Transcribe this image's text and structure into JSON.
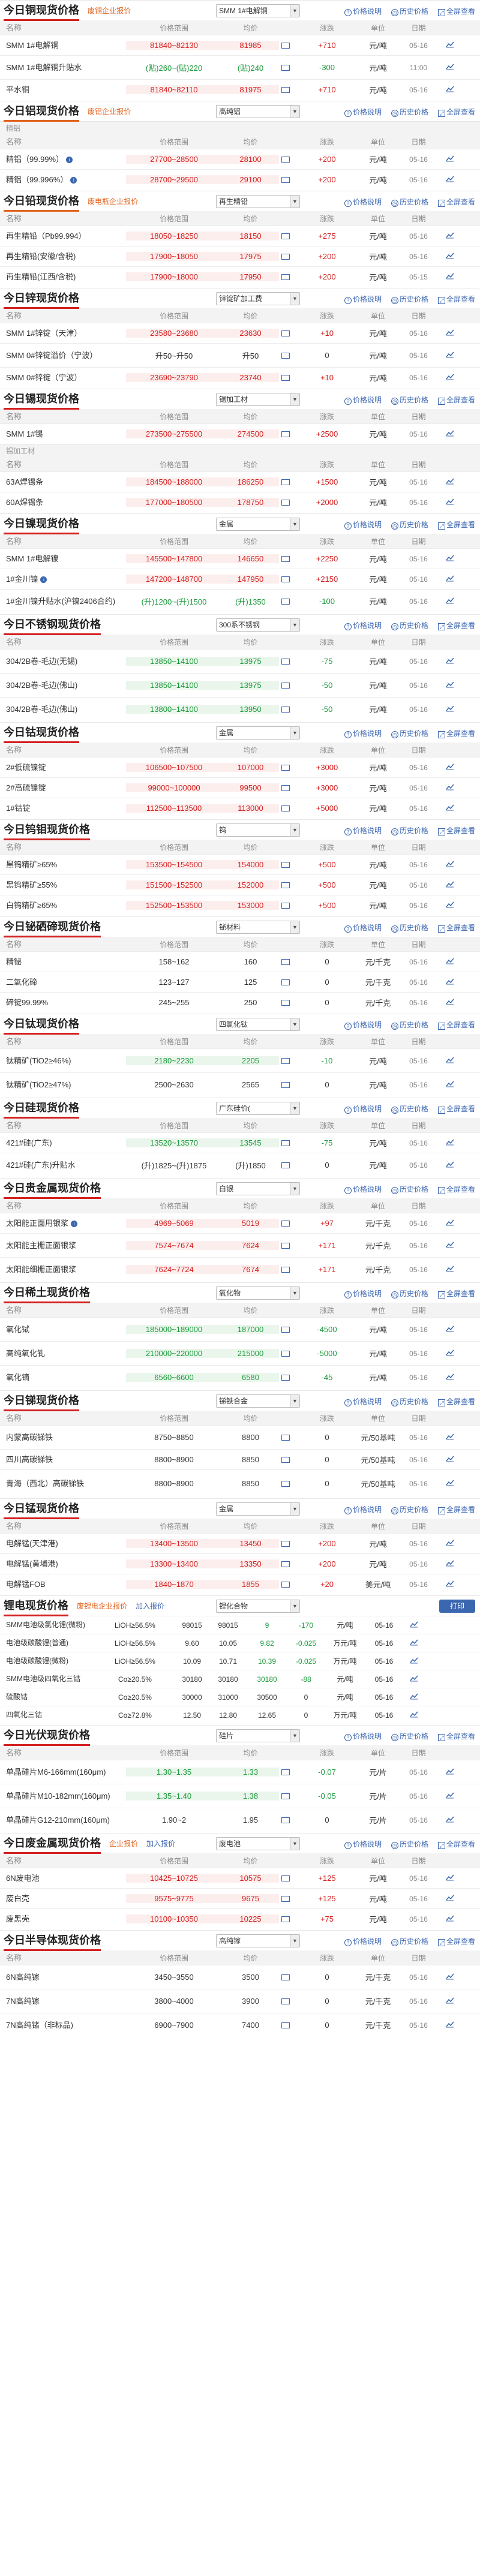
{
  "columns": {
    "name": "名称",
    "range": "价格范围",
    "avg": "均价",
    "chg": "涨跌",
    "unit": "单位",
    "date": "日期"
  },
  "group_labels": {
    "spot": "现货",
    "mid": "中间品",
    "lead_spot": "精铝",
    "zinc_spot": "锌现货",
    "tin": "锡加工材",
    "nickel": "镍"
  },
  "sections": [
    {
      "id": "copper",
      "title": "今日铜现货价格",
      "tag": "废铜企业报价",
      "select": "SMM 1#电解铜",
      "links": [
        "价格说明",
        "历史价格",
        "全屏查看"
      ],
      "rows": [
        {
          "name": "SMM 1#电解铜",
          "range": "81840~82130",
          "avg": "81985",
          "chg": "+710",
          "unit": "元/吨",
          "date": "05-16",
          "dir": "up",
          "hl": true
        },
        {
          "name": "SMM 1#电解铜升贴水",
          "range": "(贴)260~(贴)220",
          "avg": "(贴)240",
          "chg": "-300",
          "unit": "元/吨",
          "date": "11:00",
          "dir": "dn",
          "hl": false,
          "tall": true
        },
        {
          "name": "平水铜",
          "range": "81840~82110",
          "avg": "81975",
          "chg": "+710",
          "unit": "元/吨",
          "date": "05-16",
          "dir": "up",
          "hl": true
        }
      ]
    },
    {
      "id": "aluminum",
      "title": "今日铝现货价格",
      "tag": "废铝企业报价",
      "select": "高纯铝",
      "links": [
        "价格说明",
        "历史价格",
        "全屏查看"
      ],
      "group": "精铝",
      "rows": [
        {
          "name": "精铝（99.99%）",
          "range": "27700~28500",
          "avg": "28100",
          "chg": "+200",
          "unit": "元/吨",
          "date": "05-16",
          "dir": "up",
          "hl": true,
          "info": true
        },
        {
          "name": "精铝（99.996%）",
          "range": "28700~29500",
          "avg": "29100",
          "chg": "+200",
          "unit": "元/吨",
          "date": "05-16",
          "dir": "up",
          "hl": true,
          "info": true
        }
      ]
    },
    {
      "id": "lead",
      "title": "今日铅现货价格",
      "tag": "废电瓶企业报价",
      "select": "再生精铅",
      "links": [
        "价格说明",
        "历史价格",
        "全屏查看"
      ],
      "rows": [
        {
          "name": "再生精铅（Pb99.994）",
          "range": "18050~18250",
          "avg": "18150",
          "chg": "+275",
          "unit": "元/吨",
          "date": "05-16",
          "dir": "up",
          "hl": true
        },
        {
          "name": "再生精铅(安徽/含税)",
          "range": "17900~18050",
          "avg": "17975",
          "chg": "+200",
          "unit": "元/吨",
          "date": "05-16",
          "dir": "up",
          "hl": true
        },
        {
          "name": "再生精铅(江西/含税)",
          "range": "17900~18000",
          "avg": "17950",
          "chg": "+200",
          "unit": "元/吨",
          "date": "05-15",
          "dir": "up",
          "hl": true
        }
      ]
    },
    {
      "id": "zinc",
      "title": "今日锌现货价格",
      "tag": "",
      "select": "锌锭矿加工费",
      "links": [
        "价格说明",
        "历史价格",
        "全屏查看"
      ],
      "rows": [
        {
          "name": "SMM 1#锌锭（天津）",
          "range": "23580~23680",
          "avg": "23630",
          "chg": "+10",
          "unit": "元/吨",
          "date": "05-16",
          "dir": "up",
          "hl": true
        },
        {
          "name": "SMM 0#锌锭溢价（宁波）",
          "range": "升50~升50",
          "avg": "升50",
          "chg": "0",
          "unit": "元/吨",
          "date": "05-16",
          "dir": "flat",
          "hl": false,
          "tall": true
        },
        {
          "name": "SMM 0#锌锭（宁波）",
          "range": "23690~23790",
          "avg": "23740",
          "chg": "+10",
          "unit": "元/吨",
          "date": "05-16",
          "dir": "up",
          "hl": true
        }
      ]
    },
    {
      "id": "tin",
      "title": "今日锡现货价格",
      "tag": "",
      "select": "锡加工材",
      "links": [
        "价格说明",
        "历史价格",
        "全屏查看"
      ],
      "rows": [
        {
          "name": "SMM 1#锡",
          "range": "273500~275500",
          "avg": "274500",
          "chg": "+2500",
          "unit": "元/吨",
          "date": "05-16",
          "dir": "up",
          "hl": true
        }
      ],
      "group": "锡加工材",
      "hdr_after_group": true,
      "rows2": [
        {
          "name": "63A焊锡条",
          "range": "184500~188000",
          "avg": "186250",
          "chg": "+1500",
          "unit": "元/吨",
          "date": "05-16",
          "dir": "up",
          "hl": true
        },
        {
          "name": "60A焊锡条",
          "range": "177000~180500",
          "avg": "178750",
          "chg": "+2000",
          "unit": "元/吨",
          "date": "05-16",
          "dir": "up",
          "hl": true
        }
      ]
    },
    {
      "id": "nickel",
      "title": "今日镍现货价格",
      "tag": "",
      "select": "金属",
      "links": [
        "价格说明",
        "历史价格",
        "全屏查看"
      ],
      "rows": [
        {
          "name": "SMM 1#电解镍",
          "range": "145500~147800",
          "avg": "146650",
          "chg": "+2250",
          "unit": "元/吨",
          "date": "05-16",
          "dir": "up",
          "hl": true
        },
        {
          "name": "1#金川镍",
          "range": "147200~148700",
          "avg": "147950",
          "chg": "+2150",
          "unit": "元/吨",
          "date": "05-16",
          "dir": "up",
          "hl": true,
          "info": true
        },
        {
          "name": "1#金川镍升贴水(沪镍2406合约)",
          "range": "(升)1200~(升)1500",
          "avg": "(升)1350",
          "chg": "-100",
          "unit": "元/吨",
          "date": "05-16",
          "dir": "dn",
          "hl": false,
          "tall": true
        }
      ]
    },
    {
      "id": "stainless",
      "title": "今日不锈钢现货价格",
      "tag": "",
      "select": "300系不锈钢",
      "links": [
        "价格说明",
        "历史价格",
        "全屏查看"
      ],
      "rows": [
        {
          "name": "304/2B卷-毛边(无锡)",
          "range": "13850~14100",
          "avg": "13975",
          "chg": "-75",
          "unit": "元/吨",
          "date": "05-16",
          "dir": "dn",
          "hl": "g",
          "tall": true
        },
        {
          "name": "304/2B卷-毛边(佛山)",
          "range": "13850~14100",
          "avg": "13975",
          "chg": "-50",
          "unit": "元/吨",
          "date": "05-16",
          "dir": "dn",
          "hl": "g",
          "tall": true
        },
        {
          "name": "304/2B卷-毛边(佛山)",
          "range": "13800~14100",
          "avg": "13950",
          "chg": "-50",
          "unit": "元/吨",
          "date": "05-16",
          "dir": "dn",
          "hl": "g",
          "tall": true
        }
      ]
    },
    {
      "id": "cobalt",
      "title": "今日钴现货价格",
      "tag": "",
      "select": "金属",
      "links": [
        "价格说明",
        "历史价格",
        "全屏查看"
      ],
      "rows": [
        {
          "name": "2#低硫镍锭",
          "range": "106500~107500",
          "avg": "107000",
          "chg": "+3000",
          "unit": "元/吨",
          "date": "05-16",
          "dir": "up",
          "hl": true
        },
        {
          "name": "2#高硫镍锭",
          "range": "99000~100000",
          "avg": "99500",
          "chg": "+3000",
          "unit": "元/吨",
          "date": "05-16",
          "dir": "up",
          "hl": true
        },
        {
          "name": "1#钴锭",
          "range": "112500~113500",
          "avg": "113000",
          "chg": "+5000",
          "unit": "元/吨",
          "date": "05-16",
          "dir": "up",
          "hl": true
        }
      ]
    },
    {
      "id": "tungsten",
      "title": "今日钨钼现货价格",
      "tag": "",
      "select": "钨",
      "links": [
        "价格说明",
        "历史价格",
        "全屏查看"
      ],
      "rows": [
        {
          "name": "黑钨精矿≥65%",
          "range": "153500~154500",
          "avg": "154000",
          "chg": "+500",
          "unit": "元/吨",
          "date": "05-16",
          "dir": "up",
          "hl": true
        },
        {
          "name": "黑钨精矿≥55%",
          "range": "151500~152500",
          "avg": "152000",
          "chg": "+500",
          "unit": "元/吨",
          "date": "05-16",
          "dir": "up",
          "hl": true
        },
        {
          "name": "白钨精矿≥65%",
          "range": "152500~153500",
          "avg": "153000",
          "chg": "+500",
          "unit": "元/吨",
          "date": "05-16",
          "dir": "up",
          "hl": true
        }
      ]
    },
    {
      "id": "bismuth",
      "title": "今日铋硒碲现货价格",
      "tag": "",
      "select": "铋材料",
      "links": [
        "价格说明",
        "历史价格",
        "全屏查看"
      ],
      "rows": [
        {
          "name": "精铋",
          "range": "158~162",
          "avg": "160",
          "chg": "0",
          "unit": "元/千克",
          "date": "05-16",
          "dir": "flat",
          "hl": false
        },
        {
          "name": "二氧化碲",
          "range": "123~127",
          "avg": "125",
          "chg": "0",
          "unit": "元/千克",
          "date": "05-16",
          "dir": "flat",
          "hl": false
        },
        {
          "name": "碲锭99.99%",
          "range": "245~255",
          "avg": "250",
          "chg": "0",
          "unit": "元/千克",
          "date": "05-16",
          "dir": "flat",
          "hl": false
        }
      ]
    },
    {
      "id": "titanium",
      "title": "今日钛现货价格",
      "tag": "",
      "select": "四氯化钛",
      "links": [
        "价格说明",
        "历史价格",
        "全屏查看"
      ],
      "rows": [
        {
          "name": "钛精矿(TiO2≥46%)",
          "range": "2180~2230",
          "avg": "2205",
          "chg": "-10",
          "unit": "元/吨",
          "date": "05-16",
          "dir": "dn",
          "hl": "g",
          "tall": true
        },
        {
          "name": "钛精矿(TiO2≥47%)",
          "range": "2500~2630",
          "avg": "2565",
          "chg": "0",
          "unit": "元/吨",
          "date": "05-16",
          "dir": "flat",
          "hl": false,
          "tall": true
        }
      ]
    },
    {
      "id": "silicon",
      "title": "今日硅现货价格",
      "tag": "",
      "select": "广东硅价(",
      "links": [
        "价格说明",
        "历史价格",
        "全屏查看"
      ],
      "colhdr": true,
      "rows": [
        {
          "name": "421#硅(广东)",
          "range": "13520~13570",
          "avg": "13545",
          "chg": "-75",
          "unit": "元/吨",
          "date": "05-16",
          "dir": "dn",
          "hl": "g"
        },
        {
          "name": "421#硅(广东)升贴水",
          "range": "(升)1825~(升)1875",
          "avg": "(升)1850",
          "chg": "0",
          "unit": "元/吨",
          "date": "05-16",
          "dir": "flat",
          "hl": false,
          "tall": true
        }
      ]
    },
    {
      "id": "precious",
      "title": "今日贵金属现货价格",
      "tag": "",
      "select": "白银",
      "links": [
        "价格说明",
        "历史价格",
        "全屏查看"
      ],
      "rows": [
        {
          "name": "太阳能正面用银浆",
          "range": "4969~5069",
          "avg": "5019",
          "chg": "+97",
          "unit": "元/千克",
          "date": "05-16",
          "dir": "up",
          "hl": true,
          "info": true
        },
        {
          "name": "太阳能主栅正面银浆",
          "range": "7574~7674",
          "avg": "7624",
          "chg": "+171",
          "unit": "元/千克",
          "date": "05-16",
          "dir": "up",
          "hl": true,
          "tall": true
        },
        {
          "name": "太阳能细栅正面银浆",
          "range": "7624~7724",
          "avg": "7674",
          "chg": "+171",
          "unit": "元/千克",
          "date": "05-16",
          "dir": "up",
          "hl": true,
          "tall": true
        }
      ]
    },
    {
      "id": "rare",
      "title": "今日稀土现货价格",
      "tag": "",
      "select": "氧化物",
      "links": [
        "价格说明",
        "历史价格",
        "全屏查看"
      ],
      "rows": [
        {
          "name": "氧化铽",
          "range": "185000~189000",
          "avg": "187000",
          "chg": "-4500",
          "unit": "元/吨",
          "date": "05-16",
          "dir": "dn",
          "hl": "g",
          "tall": true
        },
        {
          "name": "高纯氧化钆",
          "range": "210000~220000",
          "avg": "215000",
          "chg": "-5000",
          "unit": "元/吨",
          "date": "05-16",
          "dir": "dn",
          "hl": "g",
          "tall": true
        },
        {
          "name": "氧化镝",
          "range": "6560~6600",
          "avg": "6580",
          "chg": "-45",
          "unit": "元/吨",
          "date": "05-16",
          "dir": "dn",
          "hl": "g",
          "tall": true
        }
      ]
    },
    {
      "id": "antimony",
      "title": "今日锑现货价格",
      "tag": "",
      "select": "锑铁合金",
      "links": [
        "价格说明",
        "历史价格",
        "全屏查看"
      ],
      "rows": [
        {
          "name": "内蒙高碳锑铁",
          "range": "8750~8850",
          "avg": "8800",
          "chg": "0",
          "unit": "元/50基吨",
          "date": "05-16",
          "dir": "flat",
          "hl": false,
          "tall": true
        },
        {
          "name": "四川高碳锑铁",
          "range": "8800~8900",
          "avg": "8850",
          "chg": "0",
          "unit": "元/50基吨",
          "date": "05-16",
          "dir": "flat",
          "hl": false
        },
        {
          "name": "青海（西北）高碳锑铁",
          "range": "8800~8900",
          "avg": "8850",
          "chg": "0",
          "unit": "元/50基吨",
          "date": "05-16",
          "dir": "flat",
          "hl": false,
          "xtall": true
        }
      ]
    },
    {
      "id": "manganese",
      "title": "今日锰现货价格",
      "tag": "",
      "select": "金属",
      "links": [
        "价格说明",
        "历史价格",
        "全屏查看"
      ],
      "rows": [
        {
          "name": "电解锰(天津港)",
          "range": "13400~13500",
          "avg": "13450",
          "chg": "+200",
          "unit": "元/吨",
          "date": "05-16",
          "dir": "up",
          "hl": true
        },
        {
          "name": "电解锰(黄埔港)",
          "range": "13300~13400",
          "avg": "13350",
          "chg": "+200",
          "unit": "元/吨",
          "date": "05-16",
          "dir": "up",
          "hl": true
        },
        {
          "name": "电解锰FOB",
          "range": "1840~1870",
          "avg": "1855",
          "chg": "+20",
          "unit": "美元/吨",
          "date": "05-16",
          "dir": "up",
          "hl": true
        }
      ]
    }
  ],
  "lithium": {
    "title": "锂电现货价格",
    "tag": "废锂电企业报价",
    "tag2": "加入报价",
    "select": "锂化合物",
    "links": [
      "全屏"
    ],
    "button": "打印",
    "rows": [
      {
        "name": "SMM电池级氯化锂(微粉)",
        "range": "LiOH≥56.5%",
        "p2": "98015",
        "p3": "98015",
        "p4": "9",
        "p5": "-170",
        "p6": "元/吨",
        "p7": "05-16",
        "dir": "dn"
      },
      {
        "name": "电池级碳酸锂(普通)",
        "range": "LiOH≥56.5%",
        "p2": "9.60",
        "p3": "10.05",
        "p4": "9.82",
        "p5": "-0.025",
        "p6": "万元/吨",
        "p7": "05-16",
        "dir": "dn"
      },
      {
        "name": "电池级碳酸锂(微粉)",
        "range": "LiOH≥56.5%",
        "p2": "10.09",
        "p3": "10.71",
        "p4": "10.39",
        "p5": "-0.025",
        "p6": "万元/吨",
        "p7": "05-16",
        "dir": "dn"
      },
      {
        "name": "SMM电池级四氧化三钴",
        "range": "Co≥20.5%",
        "p2": "30180",
        "p3": "30180",
        "p4": "30180",
        "p5": "-88",
        "p6": "元/吨",
        "p7": "05-16",
        "dir": "dn"
      },
      {
        "name": "硫酸钴",
        "range": "Co≥20.5%",
        "p2": "30000",
        "p3": "31000",
        "p4": "30500",
        "p5": "0",
        "p6": "元/吨",
        "p7": "05-16",
        "dir": "flat"
      },
      {
        "name": "四氧化三钴",
        "range": "Co≥72.8%",
        "p2": "12.50",
        "p3": "12.80",
        "p4": "12.65",
        "p5": "0",
        "p6": "万元/吨",
        "p7": "05-16",
        "dir": "flat"
      }
    ]
  },
  "solar": {
    "title": "今日光伏现货价格",
    "select": "硅片",
    "links": [
      "价格说明",
      "历史价格",
      "全屏查看"
    ],
    "rows": [
      {
        "name": "单晶硅片M6-166mm(160μm)",
        "range": "1.30~1.35",
        "avg": "1.33",
        "chg": "-0.07",
        "unit": "元/片",
        "date": "05-16",
        "dir": "dn",
        "hl": "g",
        "tall": true
      },
      {
        "name": "单晶硅片M10-182mm(160μm)",
        "range": "1.35~1.40",
        "avg": "1.38",
        "chg": "-0.05",
        "unit": "元/片",
        "date": "05-16",
        "dir": "dn",
        "hl": "g",
        "tall": true
      },
      {
        "name": "单晶硅片G12-210mm(160μm)",
        "range": "1.90~2",
        "avg": "1.95",
        "chg": "0",
        "unit": "元/片",
        "date": "05-16",
        "dir": "flat",
        "hl": false,
        "tall": true
      }
    ]
  },
  "scrap": {
    "title": "今日废金属现货价格",
    "tag": "企业报价",
    "tag2": "加入报价",
    "select": "废电池",
    "links": [
      "价格说明",
      "历史价格",
      "全屏查看"
    ],
    "rows": [
      {
        "name": "6N废电池",
        "range": "10425~10725",
        "avg": "10575",
        "chg": "+125",
        "unit": "元/吨",
        "date": "05-16",
        "dir": "up",
        "hl": true
      },
      {
        "name": "废白壳",
        "range": "9575~9775",
        "avg": "9675",
        "chg": "+125",
        "unit": "元/吨",
        "date": "05-16",
        "dir": "up",
        "hl": true
      },
      {
        "name": "废黑壳",
        "range": "10100~10350",
        "avg": "10225",
        "chg": "+75",
        "unit": "元/吨",
        "date": "05-16",
        "dir": "up",
        "hl": true
      }
    ]
  },
  "semi": {
    "title": "今日半导体现货价格",
    "select": "高纯镓",
    "links": [
      "价格说明",
      "历史价格",
      "全屏查看"
    ],
    "rows": [
      {
        "name": "6N高纯镓",
        "range": "3450~3550",
        "avg": "3500",
        "chg": "0",
        "unit": "元/千克",
        "date": "05-16",
        "dir": "flat",
        "hl": false,
        "tall": true
      },
      {
        "name": "7N高纯镓",
        "range": "3800~4000",
        "avg": "3900",
        "chg": "0",
        "unit": "元/千克",
        "date": "05-16",
        "dir": "flat",
        "hl": false,
        "tall": true
      },
      {
        "name": "7N高纯锗（非标品)",
        "range": "6900~7900",
        "avg": "7400",
        "chg": "0",
        "unit": "元/千克",
        "date": "05-16",
        "dir": "flat",
        "hl": false,
        "tall": true
      }
    ]
  }
}
